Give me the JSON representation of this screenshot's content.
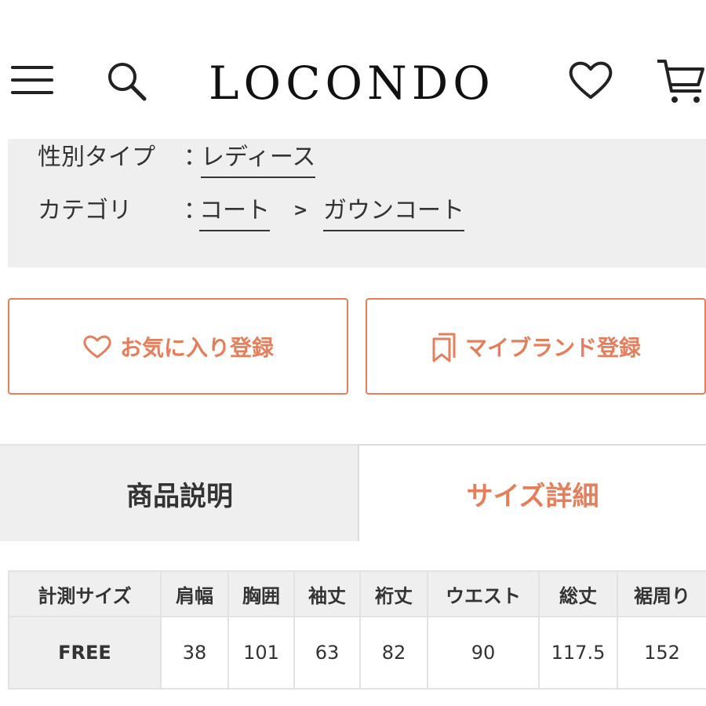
{
  "header": {
    "logo": "LOCONDO",
    "icons": {
      "menu": "hamburger-menu-icon",
      "search": "search-icon",
      "favorites": "heart-icon",
      "cart": "cart-icon"
    }
  },
  "info": {
    "gender": {
      "label": "性別タイプ",
      "colon": "：",
      "value": "レディース"
    },
    "category": {
      "label": "カテゴリ",
      "colon": "：",
      "breadcrumb": [
        "コート",
        "ガウンコート"
      ],
      "separator": ">"
    }
  },
  "actions": {
    "favorite_label": "お気に入り登録",
    "brand_label": "マイブランド登録"
  },
  "tabs": [
    {
      "label": "商品説明",
      "active": false
    },
    {
      "label": "サイズ詳細",
      "active": true
    }
  ],
  "size_table": {
    "headers": [
      "計測サイズ",
      "肩幅",
      "胸囲",
      "袖丈",
      "裄丈",
      "ウエスト",
      "総丈",
      "裾周り"
    ],
    "rows": [
      [
        "FREE",
        "38",
        "101",
        "63",
        "82",
        "90",
        "117.5",
        "152"
      ]
    ]
  },
  "colors": {
    "accent": "#e47e5b",
    "panel_bg": "#efefef",
    "text": "#333333"
  }
}
